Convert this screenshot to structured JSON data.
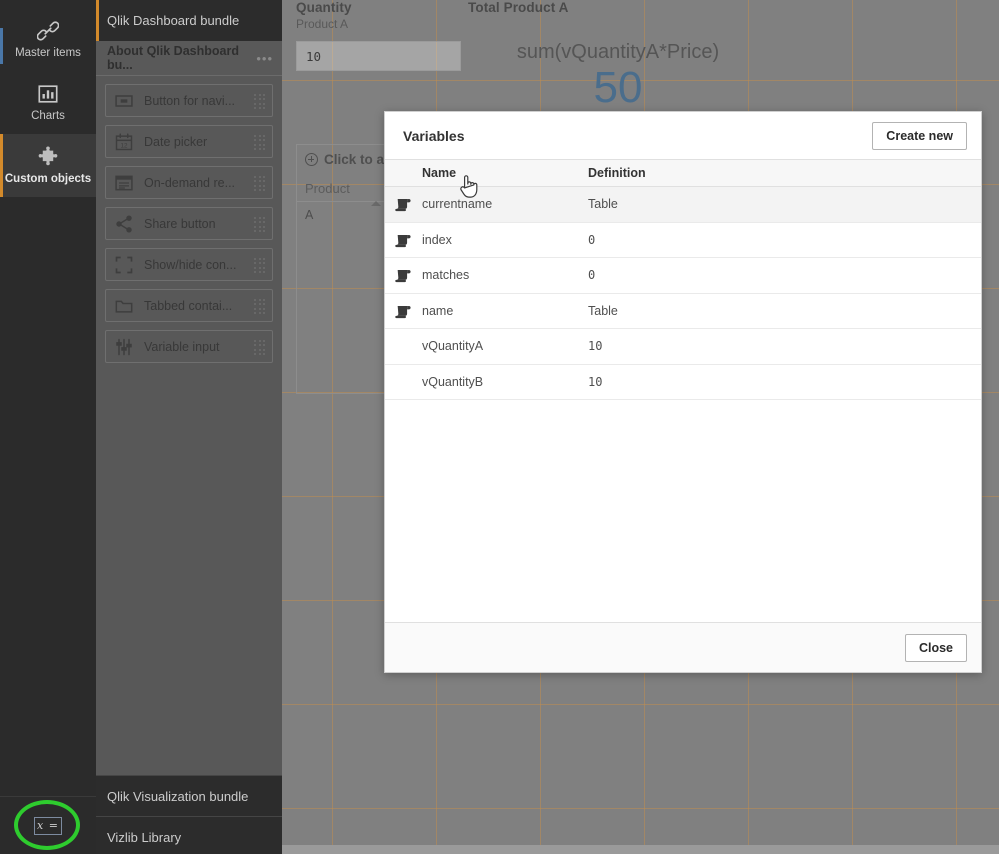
{
  "nav": {
    "items": [
      {
        "label": "Master items",
        "icon": "link-icon",
        "active": false
      },
      {
        "label": "Charts",
        "icon": "bar-chart-icon",
        "active": false
      },
      {
        "label": "Custom objects",
        "icon": "puzzle-piece-icon",
        "active": true
      }
    ],
    "variables_button": {
      "icon": "x-equals-icon",
      "label": "x =",
      "highlighted": true
    },
    "highlight_color": "#2ecc2e",
    "accent_color": "#d38a2b"
  },
  "asset_panel": {
    "open_bundle": "Qlik Dashboard bundle",
    "about": {
      "label": "About Qlik Dashboard bu...",
      "menu": "•••"
    },
    "items": [
      {
        "label": "Button for navi...",
        "icon": "button-icon"
      },
      {
        "label": "Date picker",
        "icon": "calendar-icon"
      },
      {
        "label": "On-demand re...",
        "icon": "report-icon"
      },
      {
        "label": "Share button",
        "icon": "share-icon"
      },
      {
        "label": "Show/hide con...",
        "icon": "expand-icon"
      },
      {
        "label": "Tabbed contai...",
        "icon": "folder-icon"
      },
      {
        "label": "Variable input",
        "icon": "sliders-icon"
      }
    ],
    "other_bundles": [
      "Qlik Visualization bundle",
      "Vizlib Library"
    ]
  },
  "canvas": {
    "quantity_object": {
      "title": "Quantity",
      "subtitle": "Product A",
      "input_value": "10"
    },
    "total_object": {
      "title": "Total Product A",
      "expression": "sum(vQuantityA*Price)",
      "value": "50",
      "value_color": "#4a6d8c"
    },
    "table_object": {
      "add_label": "Click to a...",
      "column": "Product",
      "rows": [
        "A"
      ]
    }
  },
  "dialog": {
    "title": "Variables",
    "create_button": "Create new",
    "close_button": "Close",
    "columns": {
      "name": "Name",
      "definition": "Definition"
    },
    "rows": [
      {
        "name": "currentname",
        "definition": "Table",
        "script": true,
        "hovered": true,
        "mono": false
      },
      {
        "name": "index",
        "definition": "0",
        "script": true,
        "hovered": false,
        "mono": true
      },
      {
        "name": "matches",
        "definition": "0",
        "script": true,
        "hovered": false,
        "mono": true
      },
      {
        "name": "name",
        "definition": "Table",
        "script": true,
        "hovered": false,
        "mono": false
      },
      {
        "name": "vQuantityA",
        "definition": "10",
        "script": false,
        "hovered": false,
        "mono": true
      },
      {
        "name": "vQuantityB",
        "definition": "10",
        "script": false,
        "hovered": false,
        "mono": true
      }
    ]
  }
}
